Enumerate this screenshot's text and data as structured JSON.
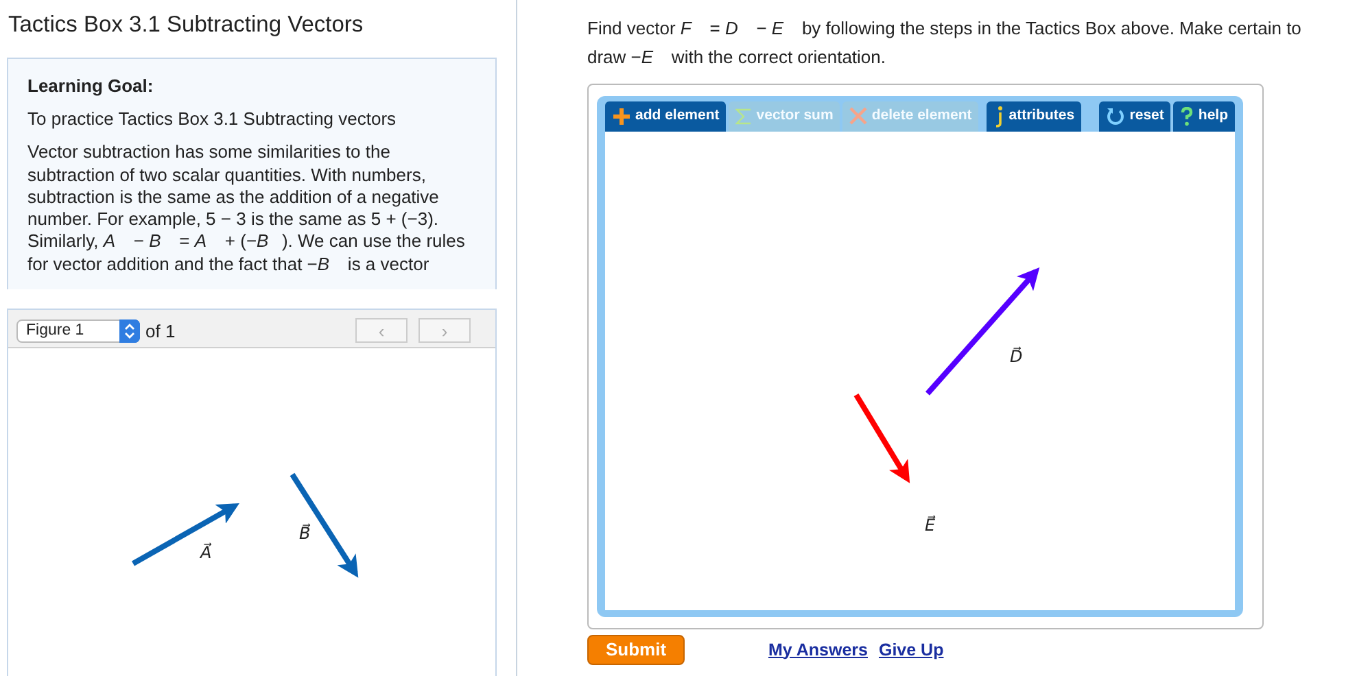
{
  "title": "Tactics Box 3.1 Subtracting Vectors",
  "learning_goal": {
    "heading": "Learning Goal:",
    "intro": "To practice Tactics Box 3.1 Subtracting vectors",
    "body": "Vector subtraction has some similarities to the subtraction of two scalar quantities. With numbers, subtraction is the same as the addition of a negative number. For example, 5 − 3 is the same as 5 + (−3). Similarly, *A⃗* − *B⃗* = *A⃗* + (−*B⃗*). We can use the rules for vector addition and the fact that −*B⃗* is a vector"
  },
  "figure": {
    "select": "Figure 1",
    "of": "of 1",
    "prev": "‹",
    "next": "›",
    "vectors": [
      {
        "label": "A⃗",
        "color": "#0a64b4"
      },
      {
        "label": "B⃗",
        "color": "#0a64b4"
      }
    ]
  },
  "question": "Find vector *F⃗* = *D⃗* − *E⃗* by following the steps in the Tactics Box above. Make certain to draw −*E⃗* with the correct orientation.",
  "tools": [
    {
      "label": "add element",
      "disabled": false
    },
    {
      "label": "vector sum",
      "disabled": true
    },
    {
      "label": "delete element",
      "disabled": true
    },
    {
      "label": "attributes",
      "disabled": false
    }
  ],
  "right_tools": [
    {
      "label": "reset"
    },
    {
      "label": "help"
    }
  ],
  "workspace_vectors": [
    {
      "label": "D⃗",
      "color": "#5500ff"
    },
    {
      "label": "E⃗",
      "color": "#ff0000"
    }
  ],
  "submit": "Submit",
  "links": [
    "My Answers",
    "Give Up"
  ]
}
